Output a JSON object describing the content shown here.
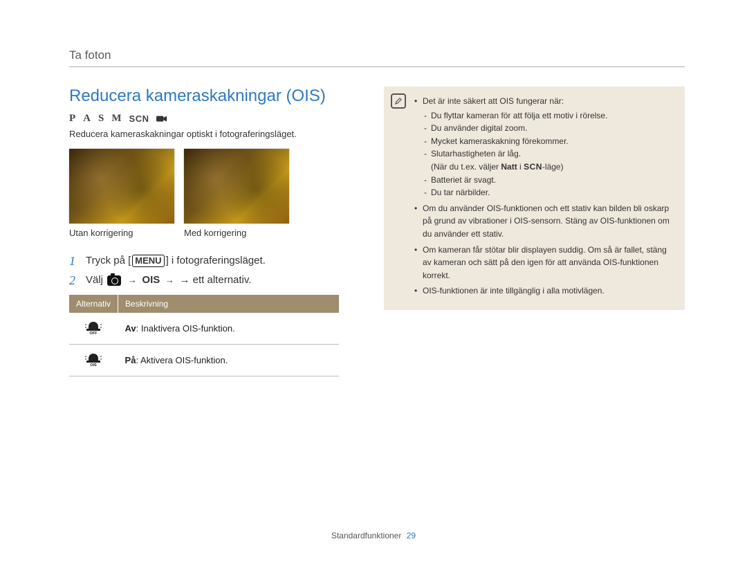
{
  "breadcrumb": "Ta foton",
  "title": "Reducera kameraskakningar (OIS)",
  "modes": [
    "P",
    "A",
    "S",
    "M",
    "SCN"
  ],
  "intro": "Reducera kameraskakningar optiskt i fotograferingsläget.",
  "image_labels": {
    "without": "Utan korrigering",
    "with": "Med korrigering"
  },
  "steps": {
    "s1_a": "Tryck på [",
    "s1_menu": "MENU",
    "s1_b": "] i fotograferingsläget.",
    "s2_a": "Välj ",
    "s2_b": " → ",
    "s2_ois": "OIS",
    "s2_c": " → ett alternativ."
  },
  "table": {
    "head_opt": "Alternativ",
    "head_desc": "Beskrivning",
    "row_off_b": "Av",
    "row_off_t": ": Inaktivera OIS-funktion.",
    "row_on_b": "På",
    "row_on_t": ": Aktivera OIS-funktion."
  },
  "note": {
    "lead": "Det är inte säkert att OIS fungerar när:",
    "sub": [
      "Du flyttar kameran för att följa ett motiv i rörelse.",
      "Du använder digital zoom.",
      "Mycket kameraskakning förekommer.",
      "Slutarhastigheten är låg."
    ],
    "sub_paren_a": "(När du t.ex. väljer ",
    "sub_paren_b": "Natt",
    "sub_paren_c": " i ",
    "sub_paren_scn": "SCN",
    "sub_paren_d": "-läge)",
    "sub2": [
      "Batteriet är svagt.",
      "Du tar närbilder."
    ],
    "b2": "Om du använder OIS-funktionen och ett stativ kan bilden bli oskarp på grund av vibrationer i OIS-sensorn. Stäng av OIS-funktionen om du använder ett stativ.",
    "b3": "Om kameran får stötar blir displayen suddig. Om så är fallet, stäng av kameran och sätt på den igen för att använda OIS-funktionen korrekt.",
    "b4": "OIS-funktionen är inte tillgänglig i alla motivlägen."
  },
  "footer": {
    "section": "Standardfunktioner",
    "page": "29"
  }
}
